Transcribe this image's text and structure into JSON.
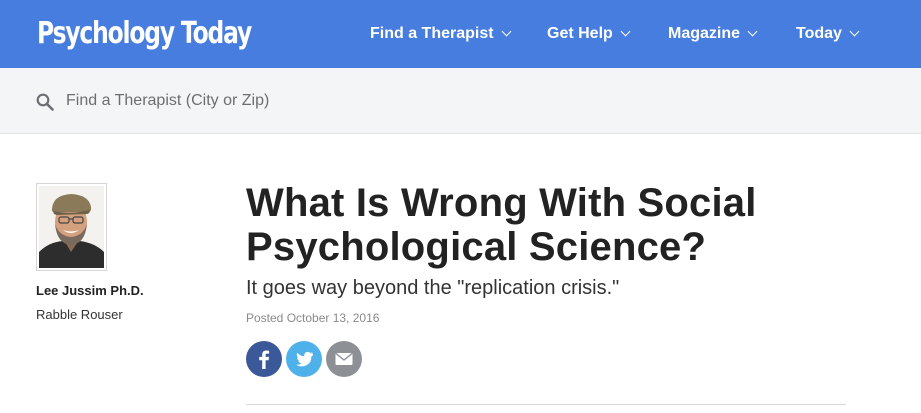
{
  "header": {
    "logo_text": "Psychology Today",
    "nav": [
      {
        "label": "Find a Therapist"
      },
      {
        "label": "Get Help"
      },
      {
        "label": "Magazine"
      },
      {
        "label": "Today"
      }
    ]
  },
  "search": {
    "placeholder": "Find a Therapist (City or Zip)",
    "value": ""
  },
  "author": {
    "name": "Lee Jussim Ph.D.",
    "blog": "Rabble Rouser"
  },
  "article": {
    "title": "What Is Wrong With Social Psychological Science?",
    "subtitle": "It goes way beyond the \"replication crisis.\"",
    "posted": "Posted October 13, 2016"
  },
  "share": {
    "icons": [
      "facebook-icon",
      "twitter-icon",
      "email-icon"
    ]
  },
  "colors": {
    "nav_bg": "#477dde",
    "facebook": "#3b5998",
    "twitter": "#4fb1e9",
    "email": "#8d9196"
  }
}
